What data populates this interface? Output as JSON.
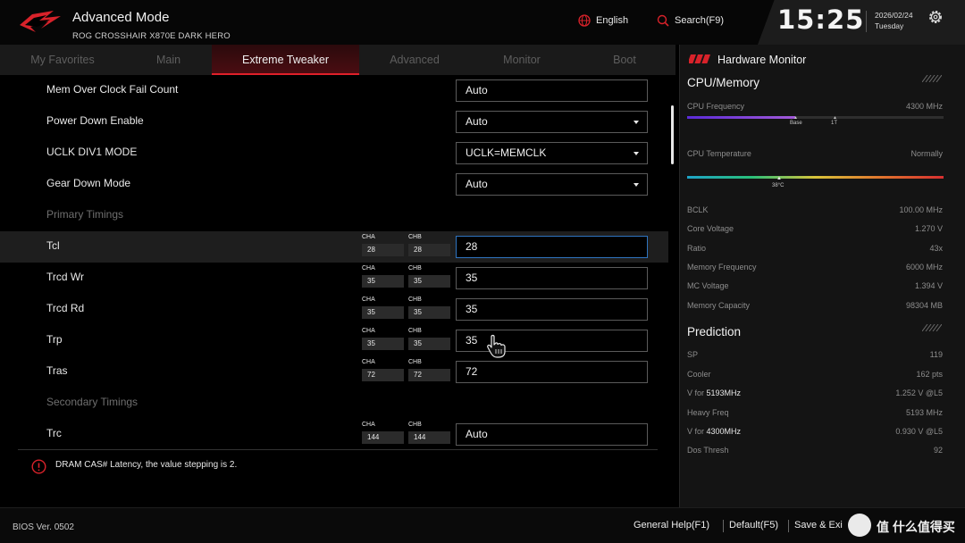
{
  "header": {
    "mode_title": "Advanced Mode",
    "board_name": "ROG CROSSHAIR X870E DARK HERO",
    "language": "English",
    "search": "Search(F9)",
    "time": "15:25",
    "date": "2026/02/24",
    "weekday": "Tuesday",
    "icons": [
      "rog-logo-icon",
      "globe-icon",
      "search-icon",
      "gear-icon"
    ]
  },
  "tabs": [
    {
      "label": "My Favorites",
      "active": false
    },
    {
      "label": "Main",
      "active": false
    },
    {
      "label": "Extreme Tweaker",
      "active": true
    },
    {
      "label": "Advanced",
      "active": false
    },
    {
      "label": "Monitor",
      "active": false
    },
    {
      "label": "Boot",
      "active": false
    }
  ],
  "settings": {
    "mem_oc_fail": {
      "label": "Mem Over Clock Fail Count",
      "value": "Auto"
    },
    "power_down": {
      "label": "Power Down Enable",
      "value": "Auto"
    },
    "uclk_mode": {
      "label": "UCLK DIV1 MODE",
      "value": "UCLK=MEMCLK"
    },
    "gear_down": {
      "label": "Gear Down Mode",
      "value": "Auto"
    },
    "primary_section": "Primary Timings",
    "tcl": {
      "label": "Tcl",
      "cha": "28",
      "chb": "28",
      "value": "28"
    },
    "trcdwr": {
      "label": "Trcd Wr",
      "cha": "35",
      "chb": "35",
      "value": "35"
    },
    "trcdrd": {
      "label": "Trcd Rd",
      "cha": "35",
      "chb": "35",
      "value": "35"
    },
    "trp": {
      "label": "Trp",
      "cha": "35",
      "chb": "35",
      "value": "35"
    },
    "tras": {
      "label": "Tras",
      "cha": "72",
      "chb": "72",
      "value": "72"
    },
    "secondary_section": "Secondary Timings",
    "trc": {
      "label": "Trc",
      "cha": "144",
      "chb": "144",
      "value": "Auto"
    },
    "cha_label": "CHA",
    "chb_label": "CHB"
  },
  "help": {
    "text": "DRAM CAS# Latency, the value stepping is 2.",
    "icon": "info-icon"
  },
  "hardware_monitor": {
    "title": "Hardware Monitor",
    "cpu_memory": {
      "title": "CPU/Memory",
      "cpu_frequency_label": "CPU Frequency",
      "cpu_frequency_value": "4300 MHz",
      "cpu_frequency_fraction": 0.42,
      "freq_marks": [
        "Base",
        "1T"
      ],
      "cpu_temp_label": "CPU Temperature",
      "cpu_temp_value": "Normally",
      "cpu_temp_mark": "38°C",
      "cpu_temp_fraction": 0.36,
      "items": [
        {
          "label": "BCLK",
          "value": "100.00 MHz"
        },
        {
          "label": "Core Voltage",
          "value": "1.270 V"
        },
        {
          "label": "Ratio",
          "value": "43x"
        },
        {
          "label": "Memory Frequency",
          "value": "6000 MHz"
        },
        {
          "label": "MC Voltage",
          "value": "1.394 V"
        },
        {
          "label": "Memory Capacity",
          "value": "98304 MB"
        }
      ]
    },
    "prediction": {
      "title": "Prediction",
      "items": [
        {
          "label": "SP",
          "value": "119"
        },
        {
          "label": "Cooler",
          "value": "162 pts"
        },
        {
          "label": "V for",
          "em": "5193MHz",
          "value": "1.252 V @L5"
        },
        {
          "label": "Heavy Freq",
          "value": "5193 MHz"
        },
        {
          "label": "V for",
          "em": "4300MHz",
          "value": "0.930 V @L5"
        },
        {
          "label": "Dos Thresh",
          "value": "92"
        }
      ]
    }
  },
  "footer": {
    "bios_version": "BIOS Ver. 0502",
    "general_help": "General Help(F1)",
    "default": "Default(F5)",
    "save_exit": "Save & Exi",
    "watermark": "值 什么值得买"
  },
  "colors": {
    "accent": "#e0202a",
    "focus_border": "#2f74c0",
    "panel_bg": "#141414"
  }
}
